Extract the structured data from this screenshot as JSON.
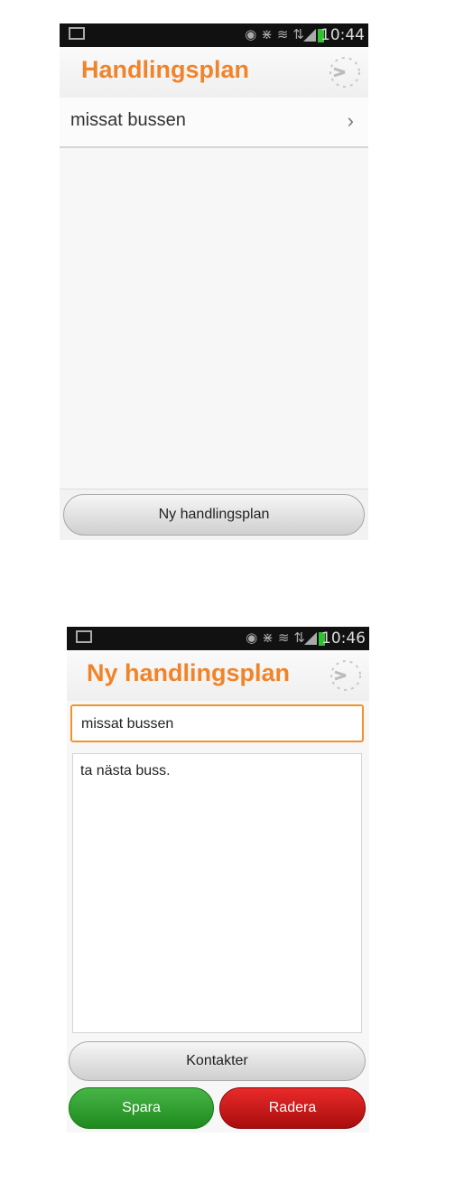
{
  "screen1": {
    "status": {
      "time": "10:44"
    },
    "title": "Handlingsplan",
    "list": [
      {
        "label": "missat bussen"
      }
    ],
    "button": "Ny handlingsplan"
  },
  "screen2": {
    "status": {
      "time": "10:46"
    },
    "title": "Ny handlingsplan",
    "title_field": "missat bussen",
    "body_field": "ta nästa buss.",
    "contacts_button": "Kontakter",
    "save_button": "Spara",
    "delete_button": "Radera"
  },
  "colors": {
    "accent": "#f0842a",
    "save": "#2e9e2e",
    "delete": "#c81414",
    "battery": "#31c231"
  },
  "icons": [
    "gallery-icon",
    "eye-icon",
    "bluetooth-icon",
    "nfc-icon",
    "hsdpa-icon",
    "signal-icon",
    "battery-icon",
    "clock-icon",
    "chevron-right-icon"
  ]
}
